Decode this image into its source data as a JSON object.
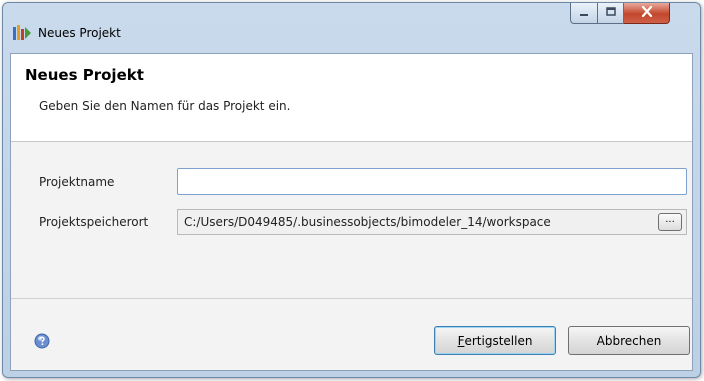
{
  "window": {
    "title": "Neues Projekt"
  },
  "banner": {
    "title": "Neues Projekt",
    "description": "Geben Sie den Namen für das Projekt ein."
  },
  "form": {
    "name_label": "Projektname",
    "name_value": "",
    "location_label": "Projektspeicherort",
    "location_value": "C:/Users/D049485/.businessobjects/bimodeler_14/workspace",
    "browse_label": "..."
  },
  "buttons": {
    "finish_mnemonic": "F",
    "finish_rest": "ertigstellen",
    "cancel_label": "Abbrechen"
  },
  "colors": {
    "help_icon": "#6a8fd0",
    "close_button": "#c2472c"
  },
  "icons": {
    "app": "eclipse-project-icon",
    "help": "help-icon",
    "minimize": "minimize-icon",
    "maximize": "maximize-icon",
    "close": "close-icon"
  }
}
